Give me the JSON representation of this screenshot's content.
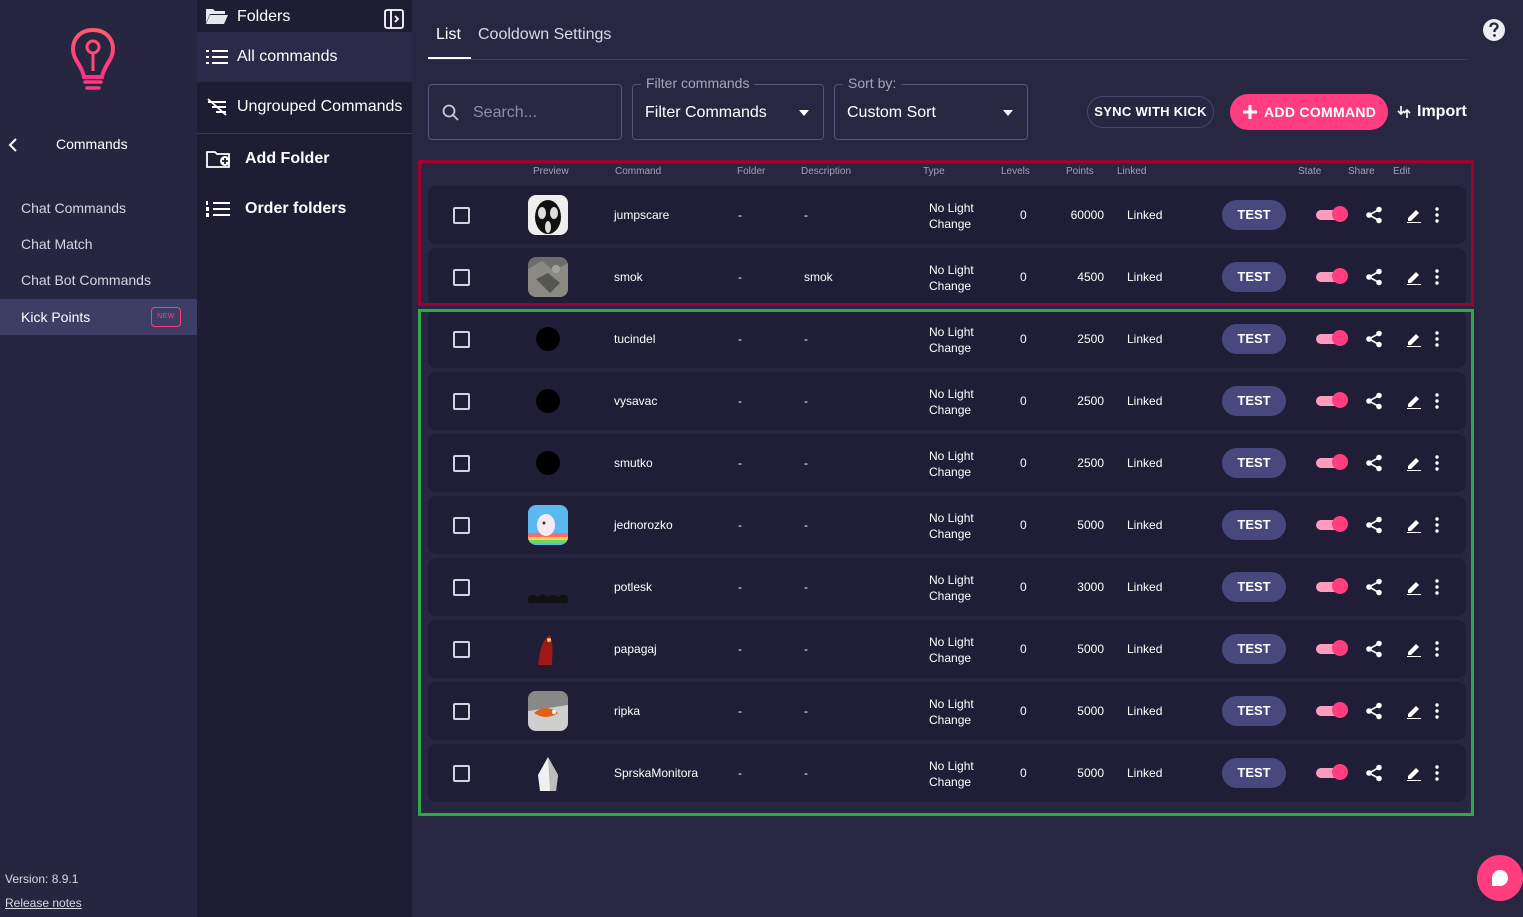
{
  "nav": {
    "title": "Commands",
    "items": [
      {
        "label": "Chat Commands"
      },
      {
        "label": "Chat Match"
      },
      {
        "label": "Chat Bot Commands"
      },
      {
        "label": "Kick Points",
        "badge": "NEW",
        "active": true
      }
    ],
    "version": "Version: 8.9.1",
    "release_notes": "Release notes"
  },
  "folders": {
    "title": "Folders",
    "items": [
      {
        "label": "All commands"
      },
      {
        "label": "Ungrouped Commands"
      },
      {
        "label": "Add Folder"
      },
      {
        "label": "Order folders"
      }
    ]
  },
  "tabs": [
    {
      "label": "List",
      "active": true
    },
    {
      "label": "Cooldown Settings"
    }
  ],
  "toolbar": {
    "search_placeholder": "Search...",
    "filter_legend": "Filter commands",
    "filter_value": "Filter Commands",
    "sort_legend": "Sort by:",
    "sort_value": "Custom Sort",
    "sync_label": "SYNC WITH KICK",
    "add_label": "ADD COMMAND",
    "import_label": "Import"
  },
  "table": {
    "headers": [
      "Preview",
      "Command",
      "Folder",
      "Description",
      "Type",
      "Levels",
      "Points",
      "Linked",
      "State",
      "Share",
      "Edit"
    ],
    "test_label": "TEST",
    "rows": [
      {
        "command": "jumpscare",
        "folder": "-",
        "description": "-",
        "type_line1": "No Light",
        "type_line2": "Change",
        "levels": "0",
        "points": "60000",
        "linked": "Linked",
        "preview": "scream-mask"
      },
      {
        "command": "smok",
        "folder": "-",
        "description": "smok",
        "type_line1": "No Light",
        "type_line2": "Change",
        "levels": "0",
        "points": "4500",
        "linked": "Linked",
        "preview": "gray-rock"
      },
      {
        "command": "tucindel",
        "folder": "-",
        "description": "-",
        "type_line1": "No Light",
        "type_line2": "Change",
        "levels": "0",
        "points": "2500",
        "linked": "Linked",
        "preview": "black-dot"
      },
      {
        "command": "vysavac",
        "folder": "-",
        "description": "-",
        "type_line1": "No Light",
        "type_line2": "Change",
        "levels": "0",
        "points": "2500",
        "linked": "Linked",
        "preview": "black-dot"
      },
      {
        "command": "smutko",
        "folder": "-",
        "description": "-",
        "type_line1": "No Light",
        "type_line2": "Change",
        "levels": "0",
        "points": "2500",
        "linked": "Linked",
        "preview": "black-dot"
      },
      {
        "command": "jednorozko",
        "folder": "-",
        "description": "-",
        "type_line1": "No Light",
        "type_line2": "Change",
        "levels": "0",
        "points": "5000",
        "linked": "Linked",
        "preview": "unicorn"
      },
      {
        "command": "potlesk",
        "folder": "-",
        "description": "-",
        "type_line1": "No Light",
        "type_line2": "Change",
        "levels": "0",
        "points": "3000",
        "linked": "Linked",
        "preview": "crowd"
      },
      {
        "command": "papagaj",
        "folder": "-",
        "description": "-",
        "type_line1": "No Light",
        "type_line2": "Change",
        "levels": "0",
        "points": "5000",
        "linked": "Linked",
        "preview": "red-parrot"
      },
      {
        "command": "ripka",
        "folder": "-",
        "description": "-",
        "type_line1": "No Light",
        "type_line2": "Change",
        "levels": "0",
        "points": "5000",
        "linked": "Linked",
        "preview": "fish"
      },
      {
        "command": "SprskaMonitora",
        "folder": "-",
        "description": "-",
        "type_line1": "No Light",
        "type_line2": "Change",
        "levels": "0",
        "points": "5000",
        "linked": "Linked",
        "preview": "white-figure"
      }
    ]
  },
  "colors": {
    "accent": "#ff3d7f",
    "background": "#282741",
    "row": "#1f1e36",
    "test_button": "#49487e",
    "frame_red": "#a0002e",
    "frame_green": "#2fa948"
  }
}
